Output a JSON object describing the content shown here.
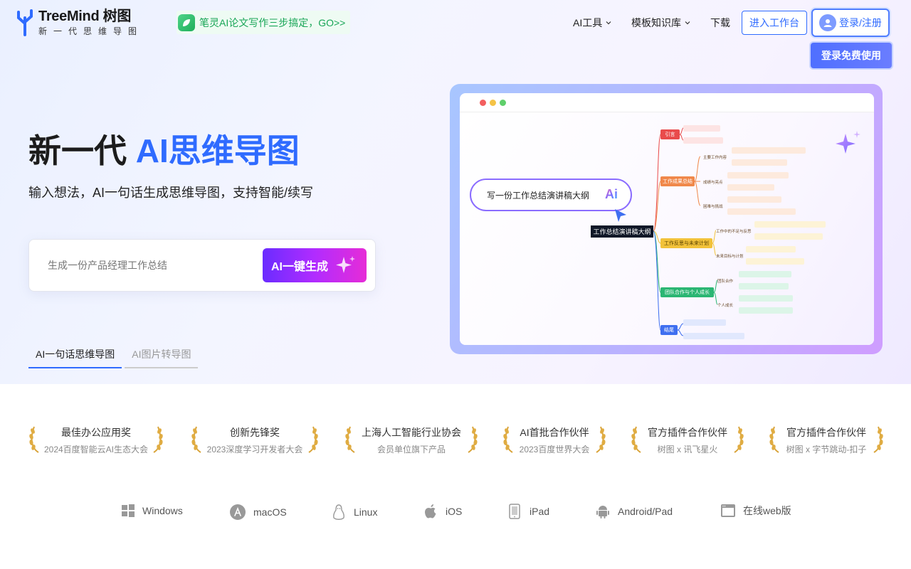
{
  "header": {
    "logo_title": "TreeMind 树图",
    "logo_sub": "新一代思维导图",
    "promo": "笔灵AI论文写作三步搞定，GO>>",
    "nav": [
      "AI工具",
      "模板知识库",
      "下载"
    ],
    "workspace_btn": "进入工作台",
    "login_btn": "登录/注册",
    "free_btn": "登录免费使用"
  },
  "hero": {
    "title_main": "新一代 ",
    "title_accent": "AI思维导图",
    "subtitle": "输入想法，AI一句话生成思维导图，支持智能/续写",
    "input_placeholder": "生成一份产品经理工作总结",
    "generate_btn": "AI一键生成",
    "tabs": [
      "AI一句话思维导图",
      "AI图片转导图"
    ]
  },
  "preview": {
    "prompt": "写一份工作总结演讲稿大纲",
    "ai_badge": "Ai",
    "root": "工作总结演讲稿大纲",
    "branches": [
      {
        "label": "引言",
        "color": "#e94b4b"
      },
      {
        "label": "工作成果总结",
        "color": "#f0884a"
      },
      {
        "label": "工作反思与未来计划",
        "color": "#f2c23a"
      },
      {
        "label": "团队合作与个人成长",
        "color": "#2bb673"
      },
      {
        "label": "结尾",
        "color": "#3f6ff0"
      }
    ],
    "subs": [
      "主要工作内容",
      "成绩与亮点",
      "困难与挑战",
      "工作中的不足与反思",
      "未来目标与计划",
      "团队合作",
      "个人成长"
    ]
  },
  "awards": [
    {
      "title": "最佳办公应用奖",
      "sub": "2024百度智能云AI生态大会"
    },
    {
      "title": "创新先锋奖",
      "sub": "2023深度学习开发者大会"
    },
    {
      "title": "上海人工智能行业协会",
      "sub": "会员单位旗下产品"
    },
    {
      "title": "AI首批合作伙伴",
      "sub": "2023百度世界大会"
    },
    {
      "title": "官方插件合作伙伴",
      "sub": "树图 x 讯飞星火"
    },
    {
      "title": "官方插件合作伙伴",
      "sub": "树图 x 字节跳动-扣子"
    }
  ],
  "platforms": [
    "Windows",
    "macOS",
    "Linux",
    "iOS",
    "iPad",
    "Android/Pad",
    "在线web版"
  ],
  "colors": {
    "accent": "#2f6bff",
    "promo_green": "#19a657"
  }
}
